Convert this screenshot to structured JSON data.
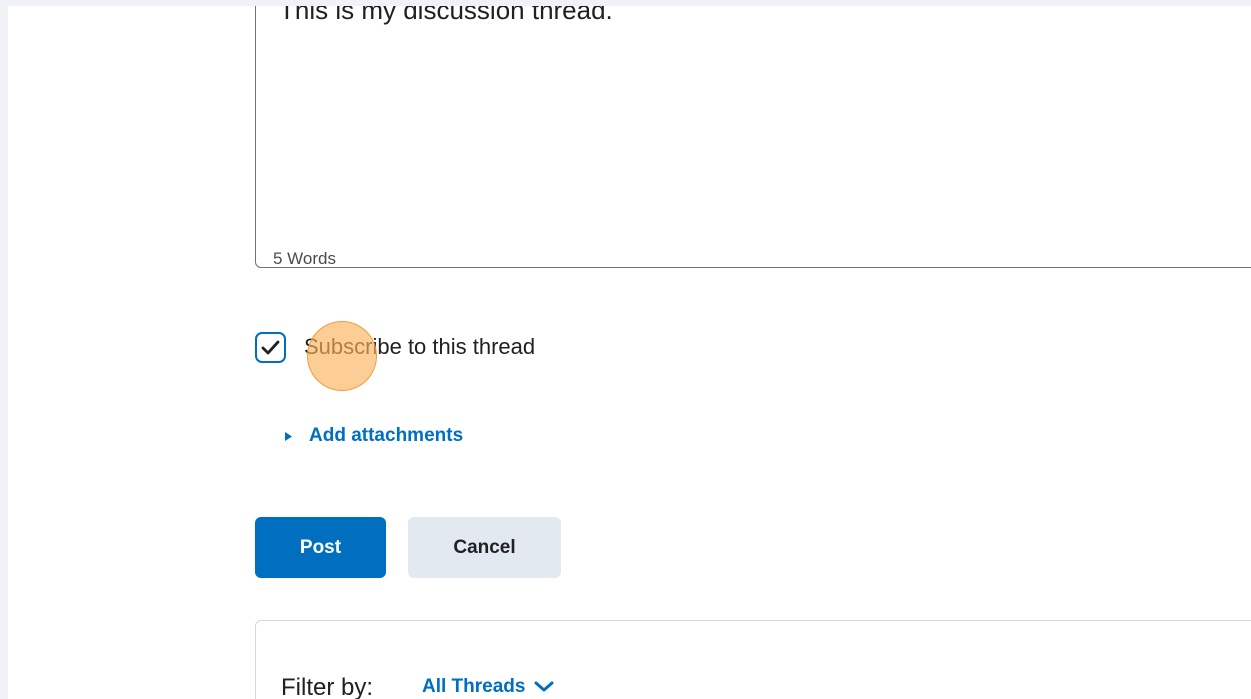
{
  "editor": {
    "content": "This is my discussion thread.",
    "word_count": "5 Words"
  },
  "subscribe": {
    "label": "Subscribe to this thread",
    "checked": true
  },
  "attachments": {
    "label": "Add attachments",
    "icon": "caret-right-icon"
  },
  "actions": {
    "post_label": "Post",
    "cancel_label": "Cancel"
  },
  "filter": {
    "label": "Filter by:",
    "value": "All Threads",
    "icon": "chevron-down-icon"
  },
  "colors": {
    "accent": "#006fbf",
    "secondary_button": "#e3e9f1",
    "click_marker": "#fbb25c"
  }
}
